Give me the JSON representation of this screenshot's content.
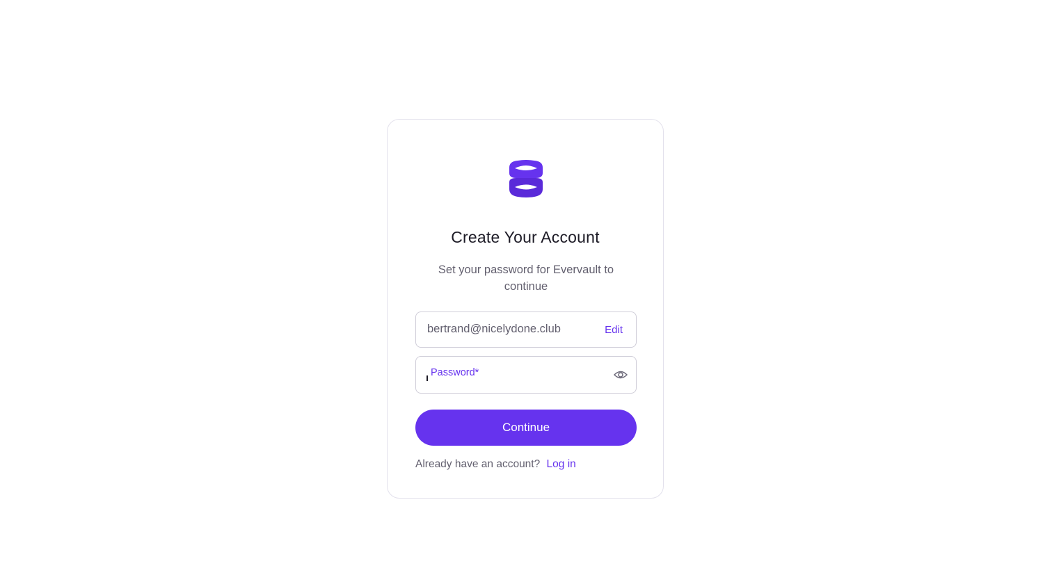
{
  "brand": {
    "logo_icon": "evervault-logo-icon",
    "accent_color": "#6633ee"
  },
  "header": {
    "title": "Create Your Account",
    "subtitle": "Set your password for Evervault to continue"
  },
  "email_field": {
    "value": "bertrand@nicelydone.club",
    "edit_label": "Edit"
  },
  "password_field": {
    "label": "Password*",
    "value": "",
    "toggle_icon": "eye-icon"
  },
  "continue_button": {
    "label": "Continue"
  },
  "footer": {
    "prompt": "Already have an account?",
    "login_label": "Log in"
  }
}
